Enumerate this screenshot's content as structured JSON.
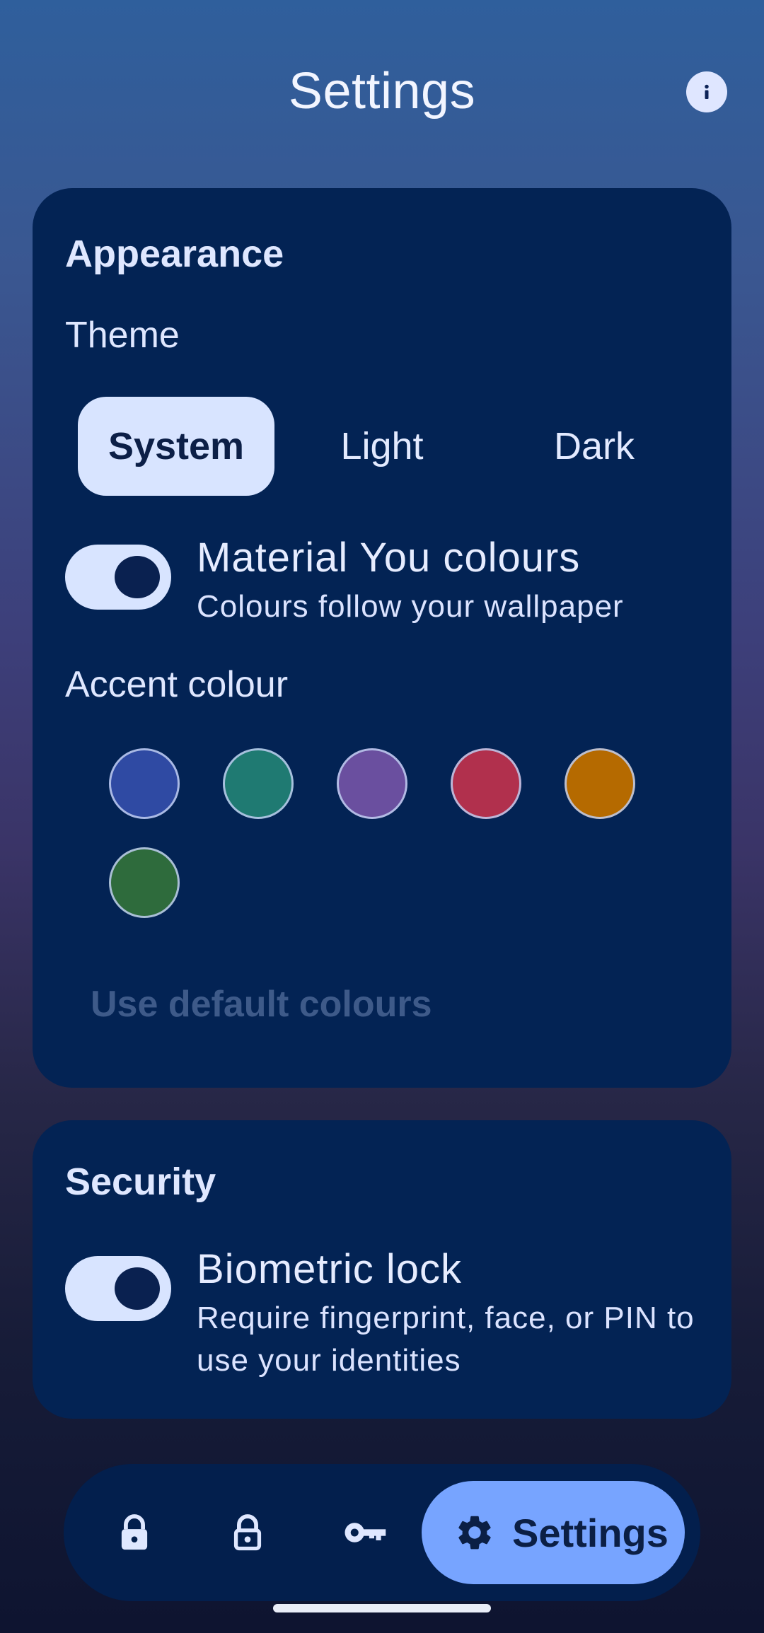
{
  "header": {
    "title": "Settings",
    "info_icon": "info-icon"
  },
  "appearance": {
    "section_title": "Appearance",
    "theme_label": "Theme",
    "theme_options": [
      "System",
      "Light",
      "Dark"
    ],
    "theme_selected": "System",
    "material_you": {
      "title": "Material You colours",
      "subtitle": "Colours follow your wallpaper",
      "enabled": true
    },
    "accent_label": "Accent colour",
    "accent_colors": [
      "#2f4aa3",
      "#1f7a72",
      "#6a4f9f",
      "#b1304d",
      "#b56a00",
      "#2e6b3c"
    ],
    "use_default_label": "Use default colours"
  },
  "security": {
    "section_title": "Security",
    "biometric": {
      "title": "Biometric lock",
      "subtitle": "Require fingerprint, face, or PIN to use your identities",
      "enabled": true
    }
  },
  "bottom_nav": {
    "items": [
      {
        "icon": "lock-icon"
      },
      {
        "icon": "unlock-icon"
      },
      {
        "icon": "key-icon"
      },
      {
        "icon": "gear-icon",
        "label": "Settings",
        "selected": true
      }
    ]
  },
  "colors": {
    "card": "#032354",
    "accent_selected": "#77a4ff",
    "chip_selected": "#d8e4ff"
  }
}
